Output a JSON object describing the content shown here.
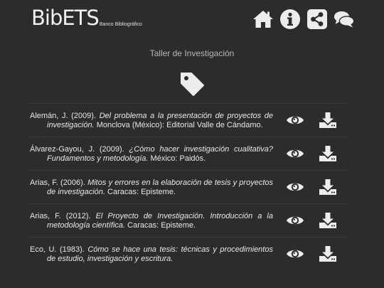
{
  "header": {
    "logo_title": "BibETS",
    "logo_subtitle": "Banco Bibliográfico",
    "nav": [
      {
        "icon": "home-icon"
      },
      {
        "icon": "info-icon"
      },
      {
        "icon": "share-icon"
      },
      {
        "icon": "comments-icon"
      }
    ]
  },
  "page_title": "Taller de Investigación",
  "references": [
    {
      "author": "Alemán, J. (2009). ",
      "title": "Del problema a la presentación de proyectos de investigación.",
      "rest": " Monclova (México): Editorial Valle de Cándamo."
    },
    {
      "author": "Álvarez-Gayou, J. (2009). ",
      "title": "¿Cómo hacer investigación cualitativa? Fundamentos y metodología.",
      "rest": " México: Paidós."
    },
    {
      "author": "Arias, F. (2006). ",
      "title": "Mitos y errores en la elaboración de tesis y proyectos de investigación.",
      "rest": " Caracas: Episteme."
    },
    {
      "author": "Arias, F. (2012). ",
      "title": "El Proyecto de Investigación. Introducción a la metodología científica.",
      "rest": " Caracas: Episteme."
    },
    {
      "author": "Eco, U. (1983). ",
      "title": "Cómo se hace una tesis: técnicas y procedimientos de estudio, investigación y escritura.",
      "rest": ""
    }
  ],
  "colors": {
    "background": "#2c2c2c",
    "text": "#e6e6e6",
    "icon": "#ececec"
  }
}
